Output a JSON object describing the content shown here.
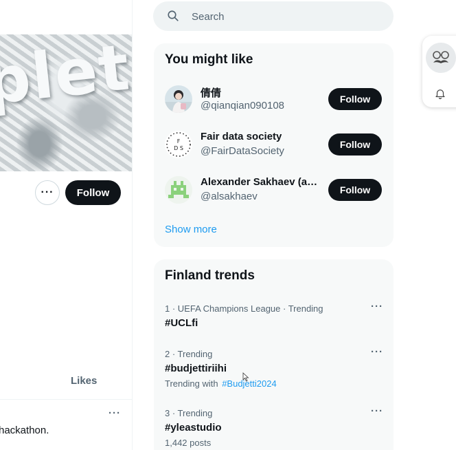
{
  "search": {
    "placeholder": "Search"
  },
  "profile": {
    "banner_text": "plets",
    "follow_label": "Follow",
    "more_label": "···",
    "likes_tab": "Likes",
    "tweet_text": "hackathon.",
    "tweet_more": "···"
  },
  "you_might_like": {
    "title": "You might like",
    "items": [
      {
        "name": "倩倩",
        "handle": "@qianqian090108",
        "follow_label": "Follow"
      },
      {
        "name": "Fair data society",
        "handle": "@FairDataSociety",
        "follow_label": "Follow",
        "logo_text": "F\nD S"
      },
      {
        "name": "Alexander Sakhaev (al…",
        "handle": "@alsakhaev",
        "follow_label": "Follow"
      }
    ],
    "show_more": "Show more"
  },
  "trends": {
    "title": "Finland trends",
    "items": [
      {
        "meta": "1 · UEFA Champions League · Trending",
        "name": "#UCLfi",
        "more": "···"
      },
      {
        "meta": "2 · Trending",
        "name": "#budjettiriihi",
        "sub_prefix": "Trending with",
        "sub_hashtag": "#Budjetti2024",
        "more": "···"
      },
      {
        "meta": "3 · Trending",
        "name": "#yleastudio",
        "sub": "1,442 posts",
        "more": "···"
      }
    ]
  },
  "colors": {
    "accent": "#1d9bf0",
    "button_dark": "#0f1419",
    "card_bg": "#f7f9f9",
    "muted_text": "#536471"
  }
}
